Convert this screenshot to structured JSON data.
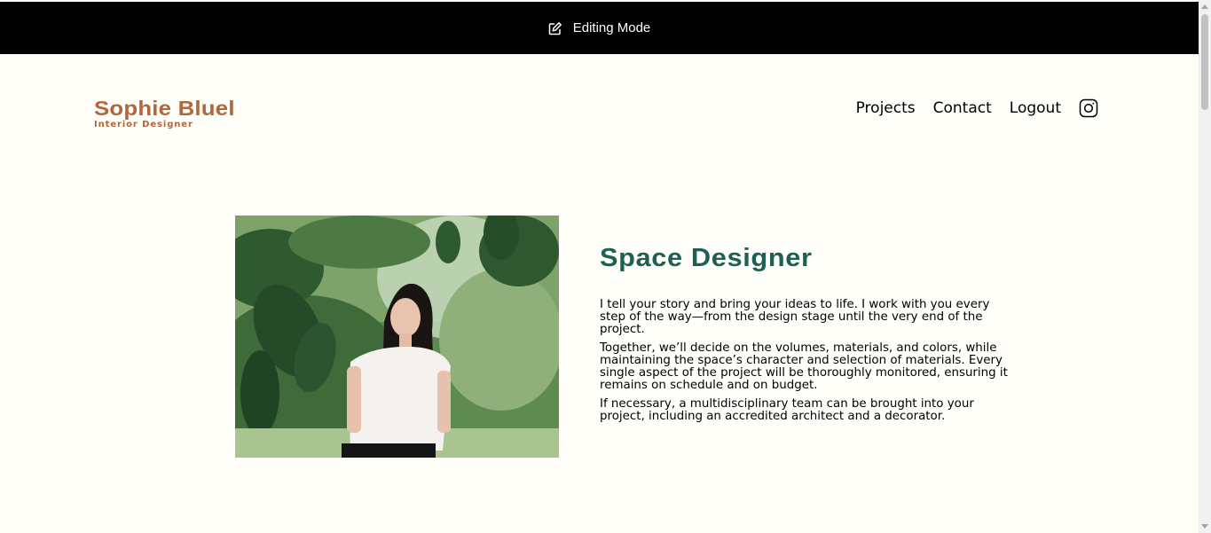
{
  "edit_bar": {
    "icon": "pen-square-icon",
    "label": "Editing Mode"
  },
  "brand": {
    "name": "Sophie Bluel",
    "subtitle": "Interior Designer",
    "color": "#B1663C"
  },
  "nav": {
    "items": [
      {
        "label": "Projects"
      },
      {
        "label": "Contact"
      },
      {
        "label": "Logout"
      }
    ],
    "social_icon": "instagram-icon"
  },
  "intro": {
    "photo_alt": "",
    "title": "Space Designer",
    "title_color": "#1D6154",
    "paragraphs": [
      "I tell your story and bring your ideas to life. I work with you every step of the way—from the design stage until the very end of the project.",
      "Together, we’ll decide on the volumes, materials, and colors, while maintaining the space’s character and selection of materials. Every single aspect of the project will be thoroughly monitored, ensuring it remains on schedule and on budget.",
      "If necessary, a multidisciplinary team can be brought into your project, including an accredited architect and a decorator."
    ]
  },
  "colors": {
    "background": "#FFFEF8",
    "edit_bar": "#000000"
  }
}
